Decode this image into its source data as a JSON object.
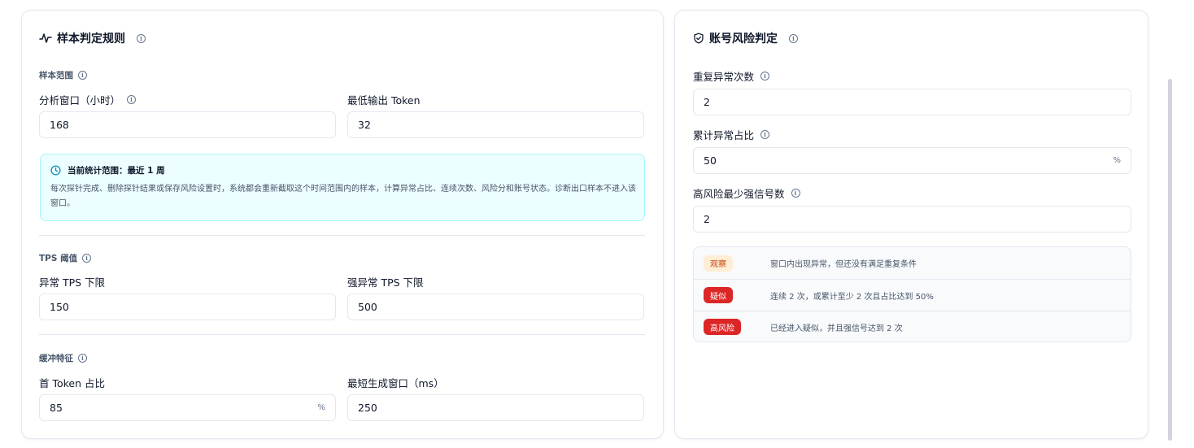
{
  "left": {
    "title": "样本判定规则",
    "sample_scope": {
      "section_label": "样本范围",
      "window_label": "分析窗口（小时）",
      "window_value": "168",
      "min_output_label": "最低输出 Token",
      "min_output_value": "32"
    },
    "notice": {
      "title": "当前统计范围：最近 1 周",
      "body": "每次探针完成、删除探针结果或保存风险设置时，系统都会重新截取这个时间范围内的样本，计算异常占比、连续次数、风险分和账号状态。诊断出口样本不进入该窗口。"
    },
    "tps": {
      "section_label": "TPS 阈值",
      "abnormal_label": "异常 TPS 下限",
      "abnormal_value": "150",
      "strong_label": "强异常 TPS 下限",
      "strong_value": "500"
    },
    "buffer": {
      "section_label": "缓冲特征",
      "first_token_label": "首 Token 占比",
      "first_token_value": "85",
      "first_token_suffix": "%",
      "min_window_label": "最短生成窗口（ms）",
      "min_window_value": "250"
    }
  },
  "right": {
    "title": "账号风险判定",
    "repeat_label": "重复异常次数",
    "repeat_value": "2",
    "ratio_label": "累计异常占比",
    "ratio_value": "50",
    "ratio_suffix": "%",
    "min_strong_label": "高风险最少强信号数",
    "min_strong_value": "2",
    "rules": [
      {
        "badge": "观察",
        "desc": "窗口内出现异常，但还没有满足重复条件"
      },
      {
        "badge": "疑似",
        "desc": "连续 2 次，或累计至少 2 次且占比达到 50%"
      },
      {
        "badge": "高风险",
        "desc": "已经进入疑似，并且强信号达到 2 次"
      }
    ]
  },
  "colors": {
    "observe_bg": "#ffedd5",
    "danger": "#dc2626",
    "notice_bg": "#ecfeff",
    "notice_border": "#a5f3fc"
  },
  "icons": {
    "left_title": "activity-pulse-icon",
    "right_title": "shield-check-icon",
    "notice": "clock-icon",
    "info": "info-icon"
  }
}
